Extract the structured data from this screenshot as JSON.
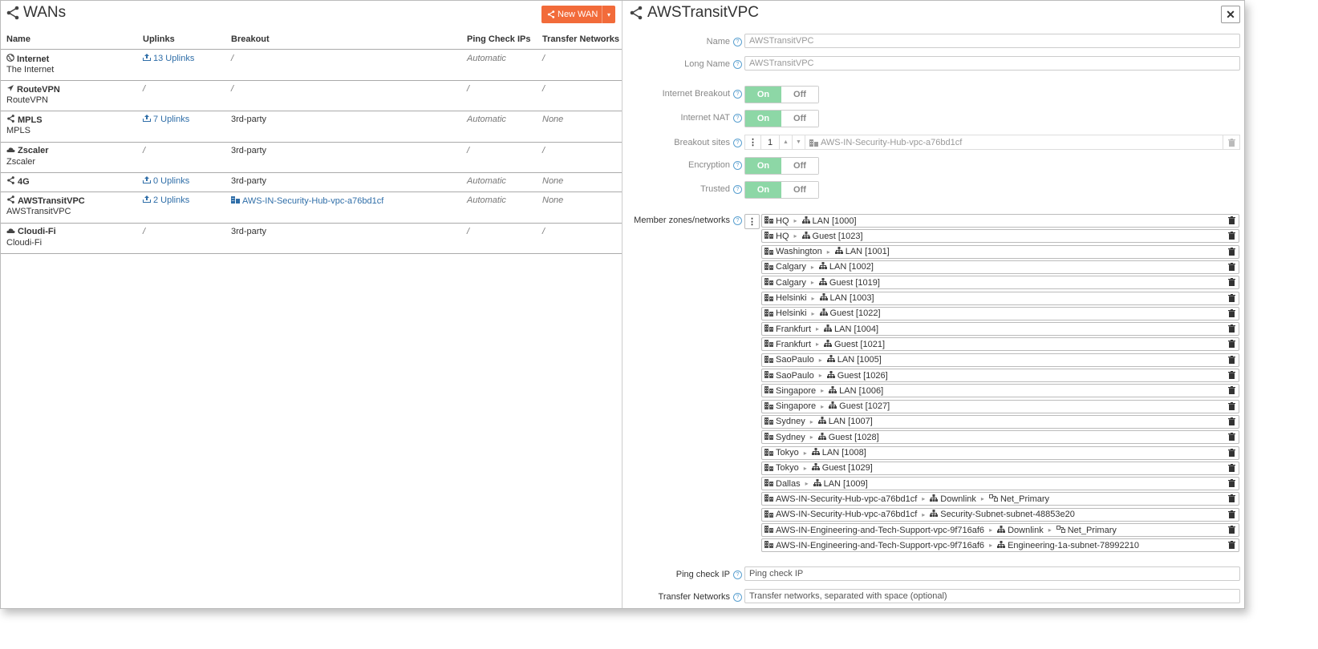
{
  "left": {
    "title": "WANs",
    "new_button": "New WAN",
    "columns": [
      "Name",
      "Uplinks",
      "Breakout",
      "Ping Check IPs",
      "Transfer Networks"
    ],
    "rows": [
      {
        "icon": "globe-icon",
        "name": "Internet",
        "desc": "The Internet",
        "uplinks": "13 Uplinks",
        "breakout": "/",
        "ping": "Automatic",
        "transfer": "/"
      },
      {
        "icon": "route-arrow-icon",
        "name": "RouteVPN",
        "desc": "RouteVPN",
        "uplinks": "/",
        "breakout": "/",
        "ping": "/",
        "transfer": "/"
      },
      {
        "icon": "share-icon",
        "name": "MPLS",
        "desc": "MPLS",
        "uplinks": "7 Uplinks",
        "breakout": "3rd-party",
        "ping": "Automatic",
        "transfer": "None"
      },
      {
        "icon": "cloud-icon",
        "name": "Zscaler",
        "desc": "Zscaler",
        "uplinks": "/",
        "breakout": "3rd-party",
        "ping": "/",
        "transfer": "/"
      },
      {
        "icon": "share-icon",
        "name": "4G",
        "desc": "",
        "uplinks": "0 Uplinks",
        "breakout": "3rd-party",
        "ping": "Automatic",
        "transfer": "None"
      },
      {
        "icon": "share-icon",
        "name": "AWSTransitVPC",
        "desc": "AWSTransitVPC",
        "uplinks": "2 Uplinks",
        "breakout": "AWS-IN-Security-Hub-vpc-a76bd1cf",
        "ping": "Automatic",
        "transfer": "None"
      },
      {
        "icon": "cloud-icon",
        "name": "Cloudi-Fi",
        "desc": "Cloudi-Fi",
        "uplinks": "/",
        "breakout": "3rd-party",
        "ping": "/",
        "transfer": "/"
      }
    ]
  },
  "right": {
    "title": "AWSTransitVPC",
    "close": "✕",
    "fields": {
      "name_label": "Name",
      "name_value": "AWSTransitVPC",
      "longname_label": "Long Name",
      "longname_value": "AWSTransitVPC",
      "breakout_label": "Internet Breakout",
      "nat_label": "Internet NAT",
      "sites_label": "Breakout sites",
      "sites_num": "1",
      "sites_value": "AWS-IN-Security-Hub-vpc-a76bd1cf",
      "encryption_label": "Encryption",
      "trusted_label": "Trusted",
      "members_label": "Member zones/networks",
      "ping_label": "Ping check IP",
      "ping_placeholder": "Ping check IP",
      "transfer_label": "Transfer Networks",
      "transfer_placeholder": "Transfer networks, separated with space (optional)"
    },
    "toggle_on": "On",
    "toggle_off": "Off",
    "members": [
      {
        "site": "HQ",
        "net": "LAN [1000]"
      },
      {
        "site": "HQ",
        "net": "Guest [1023]"
      },
      {
        "site": "Washington",
        "net": "LAN [1001]"
      },
      {
        "site": "Calgary",
        "net": "LAN [1002]"
      },
      {
        "site": "Calgary",
        "net": "Guest [1019]"
      },
      {
        "site": "Helsinki",
        "net": "LAN [1003]"
      },
      {
        "site": "Helsinki",
        "net": "Guest [1022]"
      },
      {
        "site": "Frankfurt",
        "net": "LAN [1004]"
      },
      {
        "site": "Frankfurt",
        "net": "Guest [1021]"
      },
      {
        "site": "SaoPaulo",
        "net": "LAN [1005]"
      },
      {
        "site": "SaoPaulo",
        "net": "Guest [1026]"
      },
      {
        "site": "Singapore",
        "net": "LAN [1006]"
      },
      {
        "site": "Singapore",
        "net": "Guest [1027]"
      },
      {
        "site": "Sydney",
        "net": "LAN [1007]"
      },
      {
        "site": "Sydney",
        "net": "Guest [1028]"
      },
      {
        "site": "Tokyo",
        "net": "LAN [1008]"
      },
      {
        "site": "Tokyo",
        "net": "Guest [1029]"
      },
      {
        "site": "Dallas",
        "net": "LAN [1009]"
      },
      {
        "site": "AWS-IN-Security-Hub-vpc-a76bd1cf",
        "net": "Downlink",
        "sub": "Net_Primary"
      },
      {
        "site": "AWS-IN-Security-Hub-vpc-a76bd1cf",
        "net": "Security-Subnet-subnet-48853e20"
      },
      {
        "site": "AWS-IN-Engineering-and-Tech-Support-vpc-9f716af6",
        "net": "Downlink",
        "sub": "Net_Primary"
      },
      {
        "site": "AWS-IN-Engineering-and-Tech-Support-vpc-9f716af6",
        "net": "Engineering-1a-subnet-78992210"
      }
    ]
  },
  "colors": {
    "accent": "#f26b3a",
    "link": "#2f6ea8",
    "toggle_on": "#8dd7a6"
  }
}
